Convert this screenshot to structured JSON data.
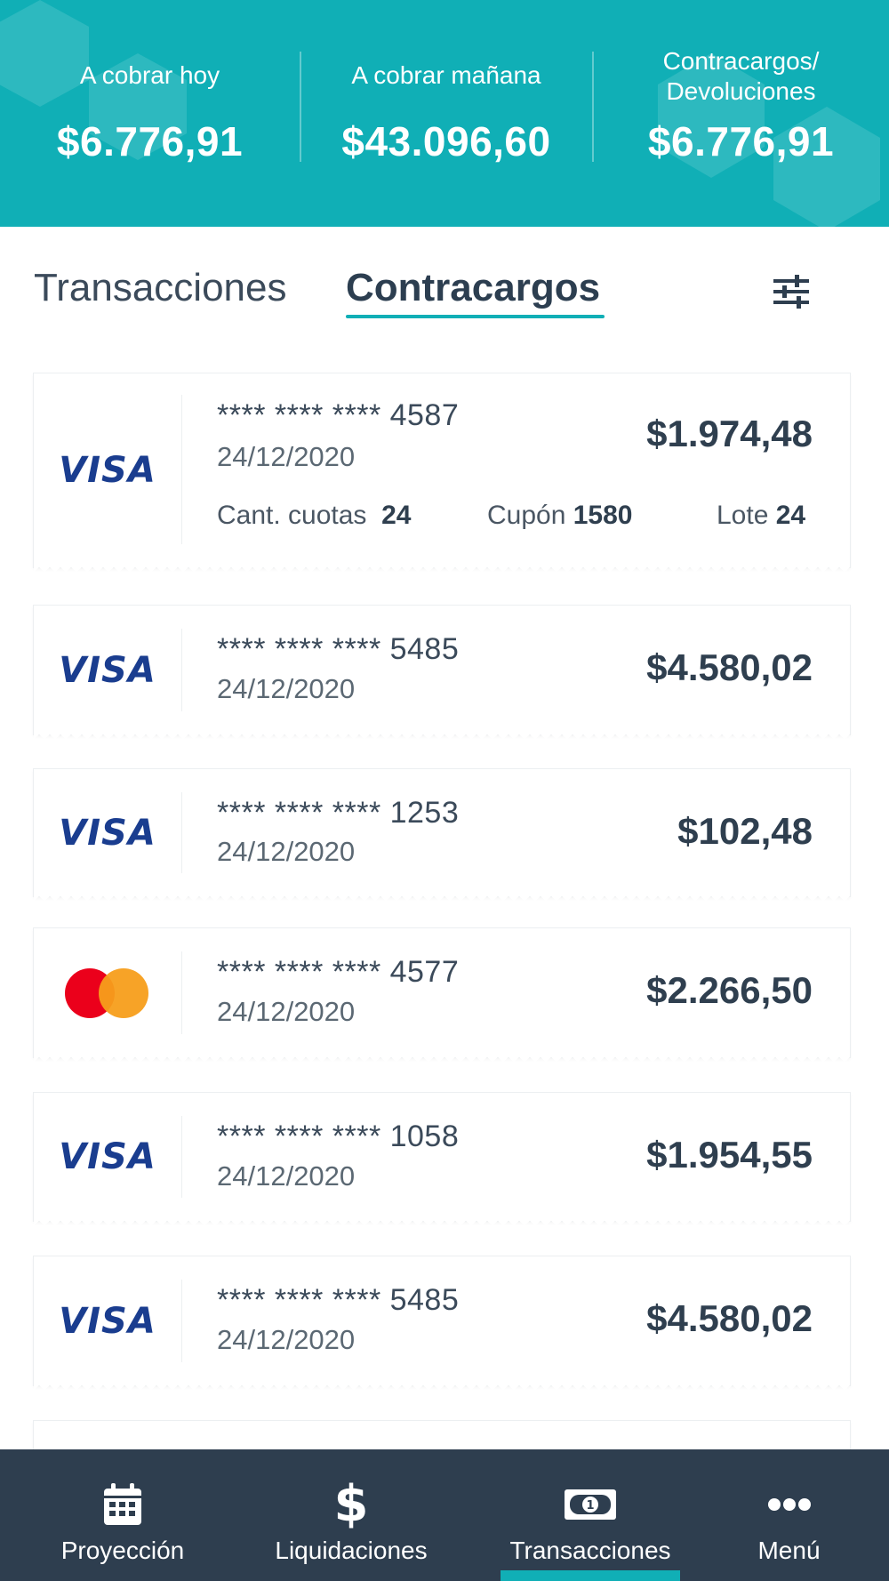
{
  "summary": {
    "today_label": "A cobrar hoy",
    "today_amount": "$6.776,91",
    "tomorrow_label": "A cobrar mañana",
    "tomorrow_amount": "$43.096,60",
    "chargebacks_label_line1": "Contracargos/",
    "chargebacks_label_line2": "Devoluciones",
    "chargebacks_amount": "$6.776,91"
  },
  "tabs": {
    "transactions": "Transacciones",
    "chargebacks": "Contracargos",
    "active": "chargebacks"
  },
  "cards": [
    {
      "brand": "visa",
      "brand_label": "VISA",
      "number": "**** **** **** 4587",
      "date": "24/12/2020",
      "amount": "$1.974,48",
      "installments_label": "Cant. cuotas",
      "installments": "24",
      "coupon_label": "Cupón",
      "coupon": "1580",
      "batch_label": "Lote",
      "batch": "24"
    },
    {
      "brand": "visa",
      "brand_label": "VISA",
      "number": "**** **** **** 5485",
      "date": "24/12/2020",
      "amount": "$4.580,02"
    },
    {
      "brand": "visa",
      "brand_label": "VISA",
      "number": "**** **** **** 1253",
      "date": "24/12/2020",
      "amount": "$102,48"
    },
    {
      "brand": "mastercard",
      "brand_label": "",
      "number": "**** **** **** 4577",
      "date": "24/12/2020",
      "amount": "$2.266,50"
    },
    {
      "brand": "visa",
      "brand_label": "VISA",
      "number": "**** **** **** 1058",
      "date": "24/12/2020",
      "amount": "$1.954,55"
    },
    {
      "brand": "visa",
      "brand_label": "VISA",
      "number": "**** **** **** 5485",
      "date": "24/12/2020",
      "amount": "$4.580,02"
    }
  ],
  "nav": {
    "projection": "Proyección",
    "settlements": "Liquidaciones",
    "transactions": "Transacciones",
    "menu": "Menú",
    "active": "transactions"
  },
  "colors": {
    "primary": "#10afb6",
    "nav_bg": "#2e3e4f",
    "visa_blue": "#1a3d8f",
    "mc_red": "#eb001b",
    "mc_orange": "#f79e1b"
  }
}
